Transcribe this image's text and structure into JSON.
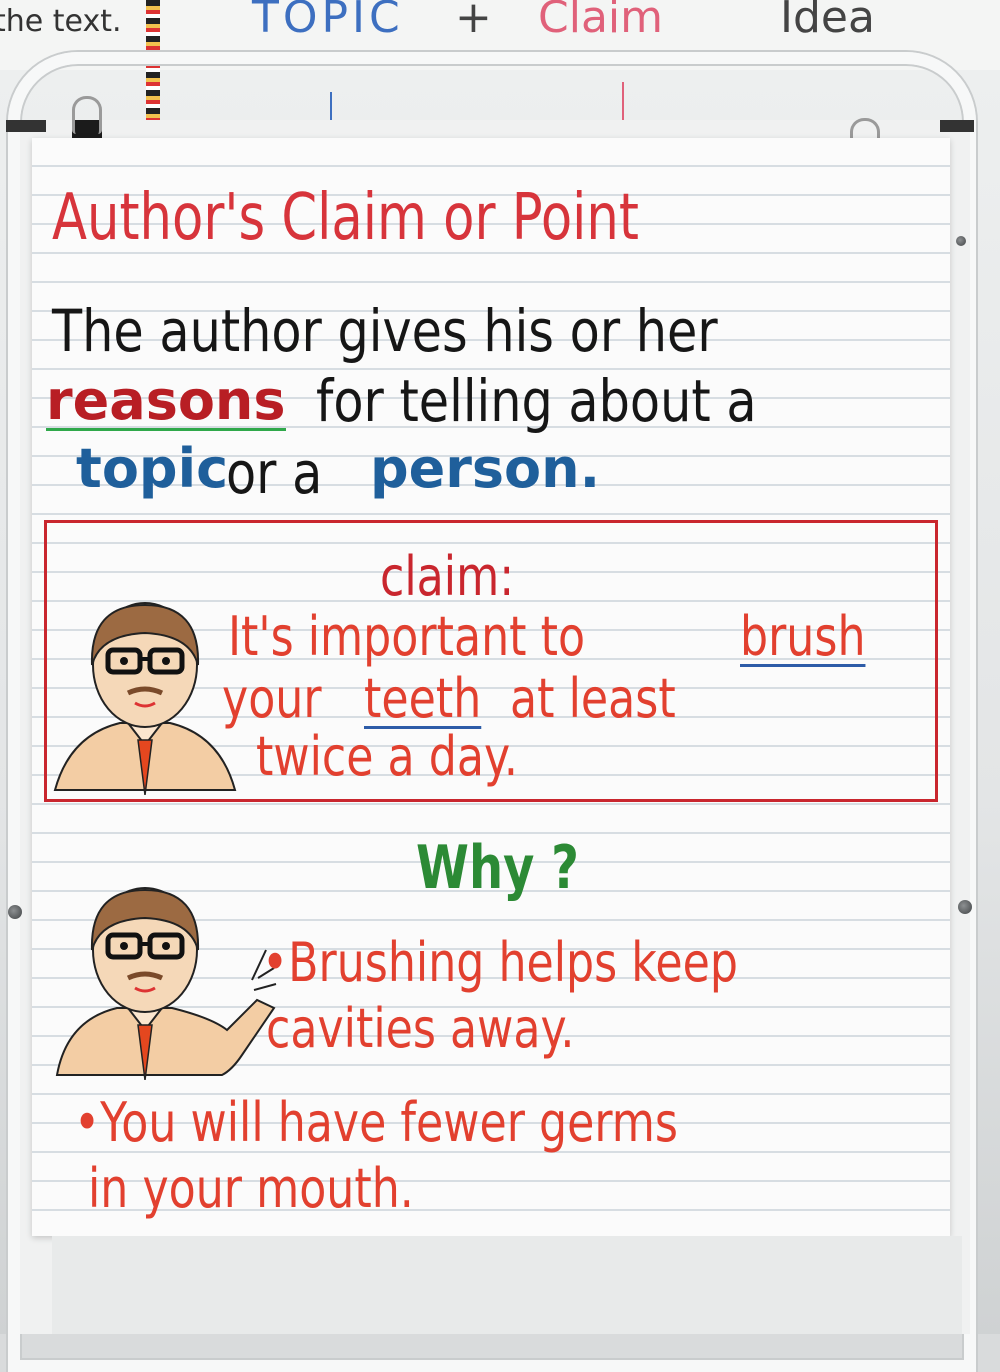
{
  "whiteboard": {
    "left_text": "the text.",
    "topic_word": "TOPIC",
    "plus": "+",
    "claim_word": "Claim",
    "idea_word": "Idea"
  },
  "chart": {
    "title": "Author's Claim or Point",
    "definition_lines": [
      "The author gives his or her",
      "for telling about a",
      "or a"
    ],
    "keywords": {
      "reasons": "reasons",
      "topic": "topic",
      "person": "person."
    },
    "claim_box": {
      "label": "claim:",
      "line1_prefix": "It's important to",
      "line1_keyword": "brush",
      "line2_prefix": "your",
      "line2_keyword": "teeth",
      "line2_suffix": "at least",
      "line3": "twice a day."
    },
    "why": "Why ?",
    "reasons_list": {
      "r1_line1": "•Brushing helps keep",
      "r1_line2": "cavities away.",
      "r2_line1": "•You will have fewer germs",
      "r2_line2": "in your mouth."
    }
  },
  "colors": {
    "title": "#d7343b",
    "reasons_keyword": "#b81e24",
    "blue_keyword": "#1f5f9b",
    "claim_text": "#e2402f",
    "why": "#2c8a35"
  }
}
